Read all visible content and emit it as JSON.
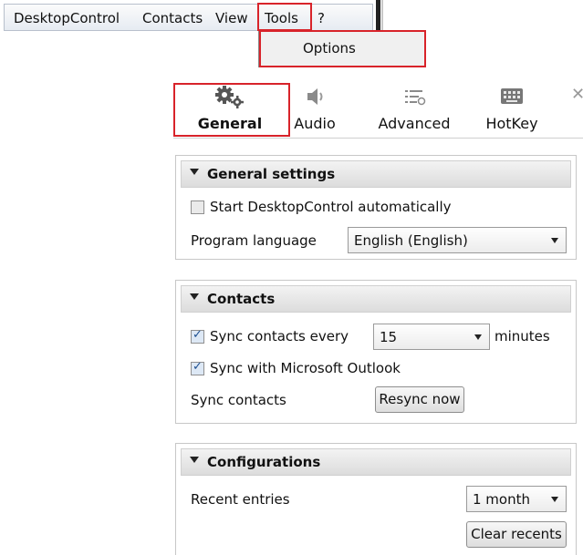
{
  "menubar": {
    "items": [
      {
        "label": "DesktopControl"
      },
      {
        "label": "Contacts"
      },
      {
        "label": "View"
      },
      {
        "label": "Tools"
      },
      {
        "label": "?"
      }
    ]
  },
  "tools_menu": {
    "options_label": "Options"
  },
  "tabs": [
    {
      "label": "General",
      "icon": "gears-icon",
      "selected": true
    },
    {
      "label": "Audio",
      "icon": "speaker-icon"
    },
    {
      "label": "Advanced",
      "icon": "advanced-list-icon"
    },
    {
      "label": "HotKey",
      "icon": "keyboard-icon"
    }
  ],
  "general_settings": {
    "title": "General settings",
    "autostart_label": "Start DesktopControl automatically",
    "autostart_checked": false,
    "language_label": "Program language",
    "language_value": "English (English)"
  },
  "contacts": {
    "title": "Contacts",
    "sync_every_label": "Sync contacts every",
    "sync_every_checked": true,
    "sync_every_value": "15",
    "minutes_label": "minutes",
    "outlook_label": "Sync with Microsoft Outlook",
    "outlook_checked": true,
    "sync_contacts_label": "Sync contacts",
    "resync_button": "Resync now"
  },
  "configurations": {
    "title": "Configurations",
    "recent_entries_label": "Recent entries",
    "recent_entries_value": "1 month",
    "clear_button": "Clear recents"
  },
  "colors": {
    "highlight": "#d8232a",
    "accent_check": "#1d4f91"
  }
}
